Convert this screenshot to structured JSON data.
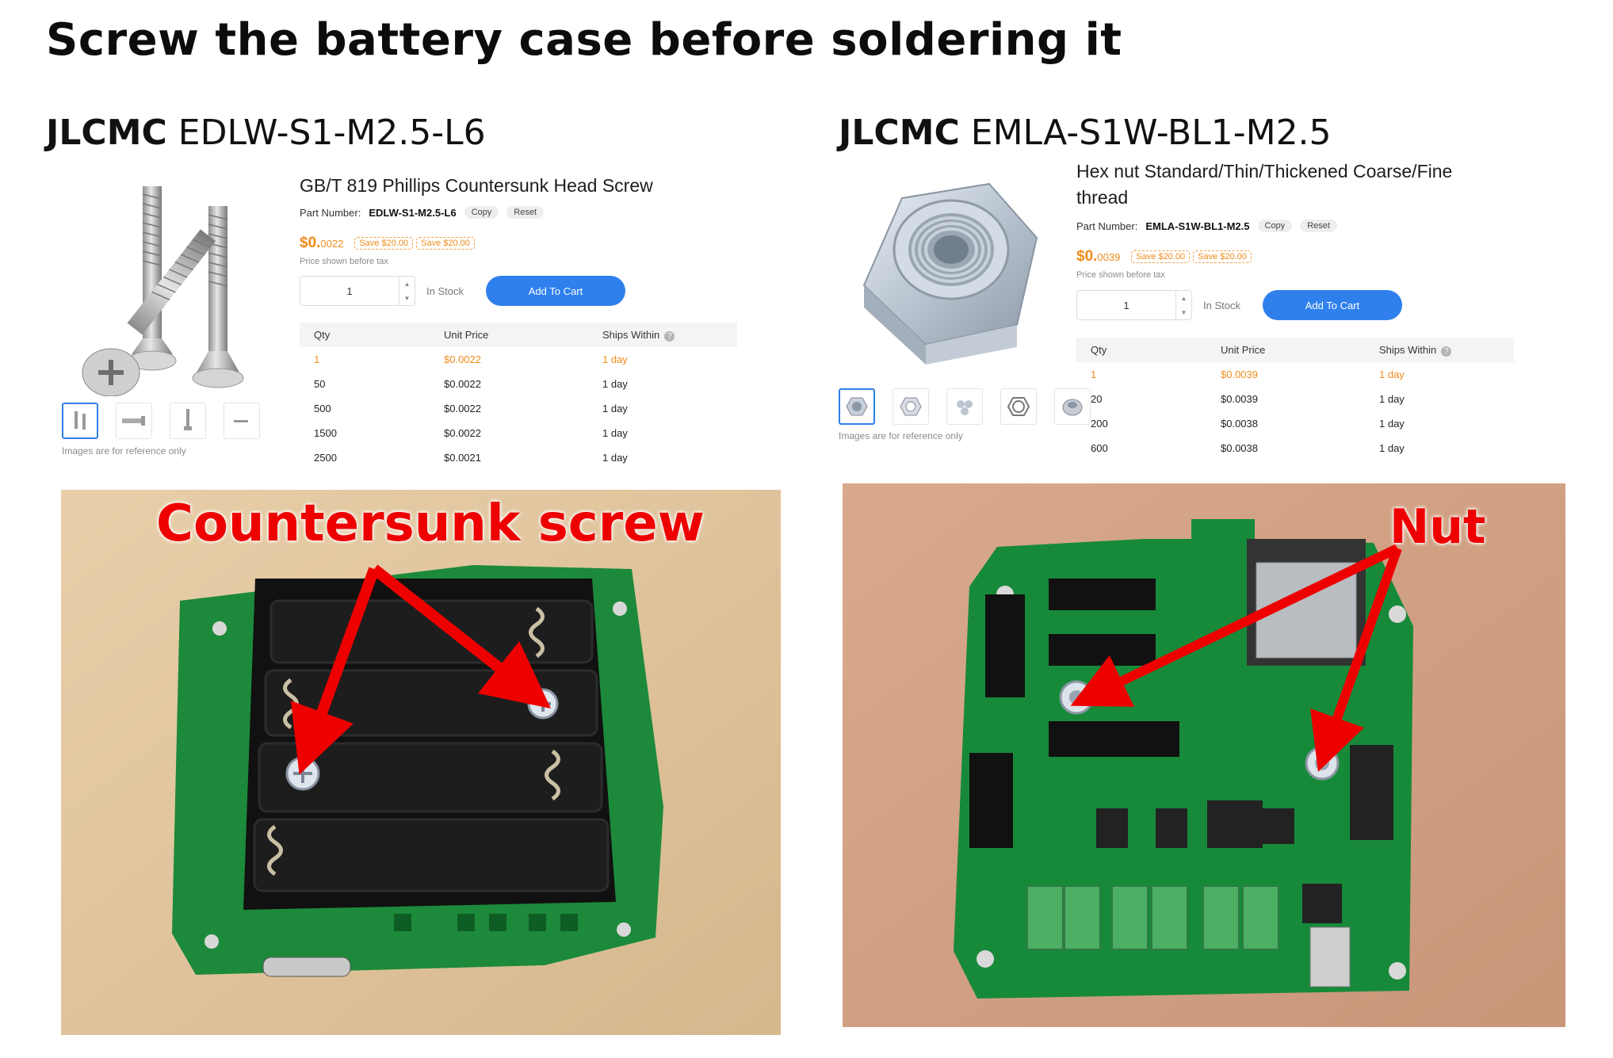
{
  "slide": {
    "title": "Screw the battery case before soldering it"
  },
  "screw": {
    "brand": "JLCMC",
    "code": "EDLW-S1-M2.5-L6",
    "product_title": "GB/T 819 Phillips Countersunk Head Screw",
    "part_number_label": "Part Number:",
    "part_number": "EDLW-S1-M2.5-L6",
    "copy_label": "Copy",
    "reset_label": "Reset",
    "price_main": "$0.",
    "price_small": "0022",
    "save_tag_1": "Save $20.00",
    "save_tag_2": "Save $20.00",
    "tax_note": "Price shown before tax",
    "qty_value": "1",
    "stock_label": "In Stock",
    "cart_label": "Add To Cart",
    "images_note": "Images are for reference only",
    "table_headers": [
      "Qty",
      "Unit Price",
      "Ships Within"
    ],
    "rows": [
      {
        "qty": "1",
        "price": "$0.0022",
        "ships": "1 day"
      },
      {
        "qty": "50",
        "price": "$0.0022",
        "ships": "1 day"
      },
      {
        "qty": "500",
        "price": "$0.0022",
        "ships": "1 day"
      },
      {
        "qty": "1500",
        "price": "$0.0022",
        "ships": "1 day"
      },
      {
        "qty": "2500",
        "price": "$0.0021",
        "ships": "1 day"
      }
    ],
    "callout": "Countersunk screw"
  },
  "nut": {
    "brand": "JLCMC",
    "code": "EMLA-S1W-BL1-M2.5",
    "product_title_line1": "Hex nut Standard/Thin/Thickened Coarse/Fine",
    "product_title_line2": "thread",
    "part_number_label": "Part Number:",
    "part_number": "EMLA-S1W-BL1-M2.5",
    "copy_label": "Copy",
    "reset_label": "Reset",
    "price_main": "$0.",
    "price_small": "0039",
    "save_tag_1": "Save $20.00",
    "save_tag_2": "Save $20.00",
    "tax_note": "Price shown before tax",
    "qty_value": "1",
    "stock_label": "In Stock",
    "cart_label": "Add To Cart",
    "images_note": "Images are for reference only",
    "table_headers": [
      "Qty",
      "Unit Price",
      "Ships Within"
    ],
    "rows": [
      {
        "qty": "1",
        "price": "$0.0039",
        "ships": "1 day"
      },
      {
        "qty": "20",
        "price": "$0.0039",
        "ships": "1 day"
      },
      {
        "qty": "200",
        "price": "$0.0038",
        "ships": "1 day"
      },
      {
        "qty": "600",
        "price": "$0.0038",
        "ships": "1 day"
      }
    ],
    "callout": "Nut"
  },
  "colors": {
    "accent": "#2f80ed",
    "price": "#f08c1a",
    "callout": "#ee0000",
    "pcb": "#1c8a3a"
  }
}
